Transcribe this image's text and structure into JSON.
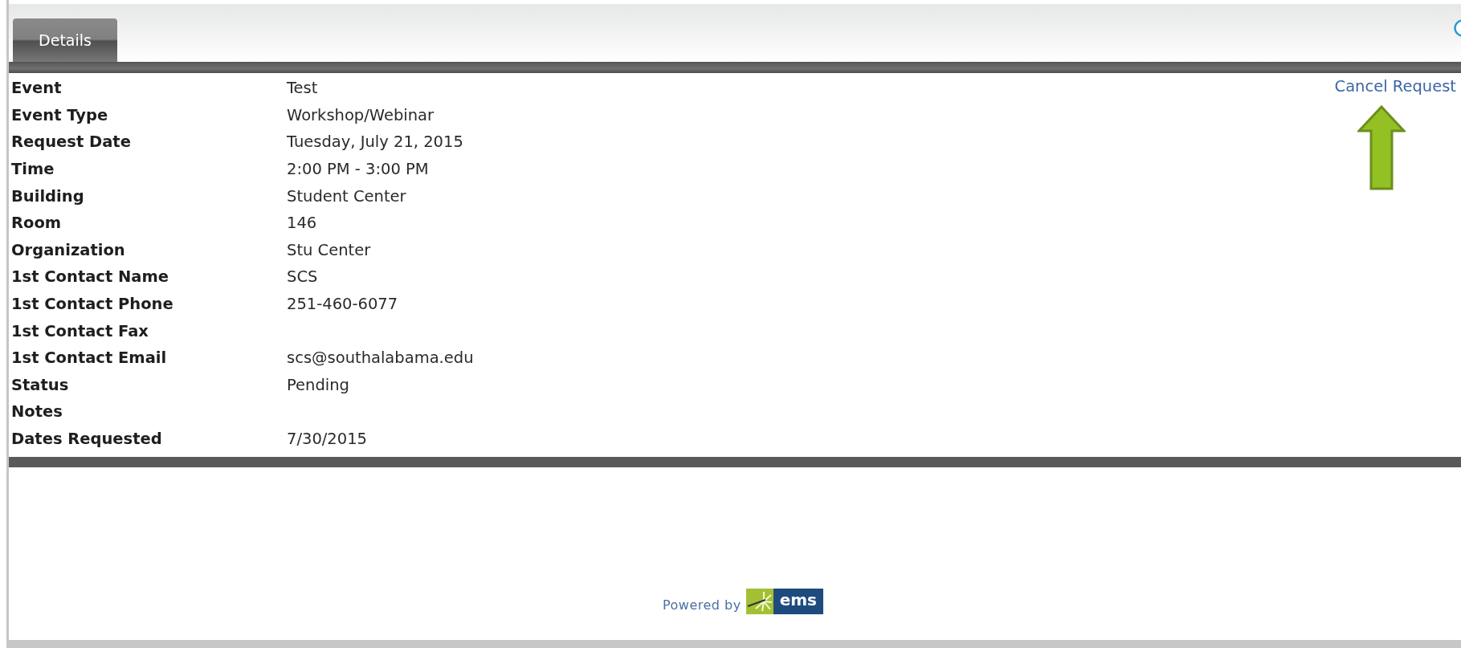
{
  "tabs": [
    {
      "label": "Details",
      "selected": true
    }
  ],
  "cancel_link": "Cancel Request",
  "fields": [
    {
      "label": "Event",
      "value": "Test"
    },
    {
      "label": "Event Type",
      "value": "Workshop/Webinar"
    },
    {
      "label": "Request Date",
      "value": "Tuesday, July 21, 2015"
    },
    {
      "label": "Time",
      "value": "2:00 PM - 3:00 PM"
    },
    {
      "label": "Building",
      "value": "Student Center"
    },
    {
      "label": "Room",
      "value": "146"
    },
    {
      "label": "Organization",
      "value": "Stu Center"
    },
    {
      "label": "1st Contact Name",
      "value": "SCS"
    },
    {
      "label": "1st Contact Phone",
      "value": "251-460-6077"
    },
    {
      "label": "1st Contact Fax"
    },
    {
      "label": "1st Contact Email",
      "value": "scs@southalabama.edu"
    },
    {
      "label": "Status",
      "value": "Pending"
    },
    {
      "label": "Notes"
    },
    {
      "label": "Dates Requested",
      "value": "7/30/2015"
    }
  ],
  "footer": {
    "powered_by": "Powered by",
    "logo_text": "ems"
  }
}
